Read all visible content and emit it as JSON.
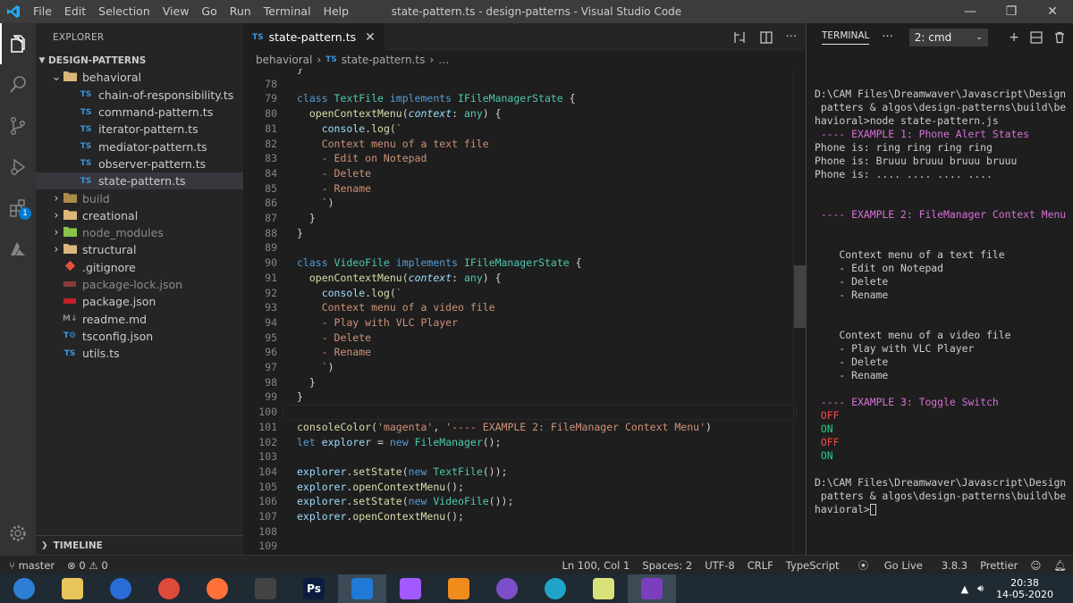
{
  "titlebar": {
    "menu": [
      "File",
      "Edit",
      "Selection",
      "View",
      "Go",
      "Run",
      "Terminal",
      "Help"
    ],
    "title": "state-pattern.ts - design-patterns - Visual Studio Code"
  },
  "activity": {
    "extensions_badge": "1"
  },
  "explorer": {
    "header": "EXPLORER",
    "root": "DESIGN-PATTERNS",
    "items": [
      {
        "label": "behavioral",
        "kind": "folder-open",
        "depth": 1
      },
      {
        "label": "chain-of-responsibility.ts",
        "kind": "ts",
        "depth": 2
      },
      {
        "label": "command-pattern.ts",
        "kind": "ts",
        "depth": 2
      },
      {
        "label": "iterator-pattern.ts",
        "kind": "ts",
        "depth": 2
      },
      {
        "label": "mediator-pattern.ts",
        "kind": "ts",
        "depth": 2
      },
      {
        "label": "observer-pattern.ts",
        "kind": "ts",
        "depth": 2
      },
      {
        "label": "state-pattern.ts",
        "kind": "ts",
        "depth": 2,
        "selected": true
      },
      {
        "label": "build",
        "kind": "folder-dim",
        "depth": 1
      },
      {
        "label": "creational",
        "kind": "folder",
        "depth": 1
      },
      {
        "label": "node_modules",
        "kind": "folder-node",
        "depth": 1
      },
      {
        "label": "structural",
        "kind": "folder",
        "depth": 1
      },
      {
        "label": ".gitignore",
        "kind": "git",
        "depth": 1
      },
      {
        "label": "package-lock.json",
        "kind": "npm-dim",
        "depth": 1
      },
      {
        "label": "package.json",
        "kind": "npm",
        "depth": 1
      },
      {
        "label": "readme.md",
        "kind": "md",
        "depth": 1
      },
      {
        "label": "tsconfig.json",
        "kind": "tsconfig",
        "depth": 1
      },
      {
        "label": "utils.ts",
        "kind": "ts",
        "depth": 1
      }
    ],
    "timeline": "TIMELINE",
    "icons": {
      "ts": "TS",
      "md": "M↓",
      "tsconfig": "T⚙"
    }
  },
  "editor": {
    "tab_label": "state-pattern.ts",
    "tab_icon": "TS",
    "breadcrumb": [
      "behavioral",
      "state-pattern.ts",
      "…"
    ],
    "breadcrumb_icon": "TS",
    "code": [
      {
        "n": "",
        "parts": [
          [
            "pl",
            "}"
          ]
        ]
      },
      {
        "n": "78",
        "parts": []
      },
      {
        "n": "79",
        "parts": [
          [
            "kb",
            "class "
          ],
          [
            "cls",
            "TextFile "
          ],
          [
            "kb",
            "implements "
          ],
          [
            "cls",
            "IFileManagerState "
          ],
          [
            "pl",
            "{"
          ]
        ]
      },
      {
        "n": "80",
        "parts": [
          [
            "pl",
            "  "
          ],
          [
            "fn",
            "openContextMenu"
          ],
          [
            "pl",
            "("
          ],
          [
            "prm",
            "context"
          ],
          [
            "pl",
            ": "
          ],
          [
            "ty",
            "any"
          ],
          [
            "pl",
            ") {"
          ]
        ]
      },
      {
        "n": "81",
        "parts": [
          [
            "pl",
            "    "
          ],
          [
            "vr",
            "console"
          ],
          [
            "pl",
            "."
          ],
          [
            "fn",
            "log"
          ],
          [
            "pl",
            "("
          ],
          [
            "str",
            "`"
          ]
        ]
      },
      {
        "n": "82",
        "parts": [
          [
            "str",
            "    Context menu of a text file"
          ]
        ]
      },
      {
        "n": "83",
        "parts": [
          [
            "str",
            "    - Edit on Notepad"
          ]
        ]
      },
      {
        "n": "84",
        "parts": [
          [
            "str",
            "    - Delete"
          ]
        ]
      },
      {
        "n": "85",
        "parts": [
          [
            "str",
            "    - Rename"
          ]
        ]
      },
      {
        "n": "86",
        "parts": [
          [
            "str",
            "    `"
          ],
          [
            "pl",
            ")"
          ]
        ]
      },
      {
        "n": "87",
        "parts": [
          [
            "pl",
            "  }"
          ]
        ]
      },
      {
        "n": "88",
        "parts": [
          [
            "pl",
            "}"
          ]
        ]
      },
      {
        "n": "89",
        "parts": []
      },
      {
        "n": "90",
        "parts": [
          [
            "kb",
            "class "
          ],
          [
            "cls",
            "VideoFile "
          ],
          [
            "kb",
            "implements "
          ],
          [
            "cls",
            "IFileManagerState "
          ],
          [
            "pl",
            "{"
          ]
        ]
      },
      {
        "n": "91",
        "parts": [
          [
            "pl",
            "  "
          ],
          [
            "fn",
            "openContextMenu"
          ],
          [
            "pl",
            "("
          ],
          [
            "prm",
            "context"
          ],
          [
            "pl",
            ": "
          ],
          [
            "ty",
            "any"
          ],
          [
            "pl",
            ") {"
          ]
        ]
      },
      {
        "n": "92",
        "parts": [
          [
            "pl",
            "    "
          ],
          [
            "vr",
            "console"
          ],
          [
            "pl",
            "."
          ],
          [
            "fn",
            "log"
          ],
          [
            "pl",
            "("
          ],
          [
            "str",
            "`"
          ]
        ]
      },
      {
        "n": "93",
        "parts": [
          [
            "str",
            "    Context menu of a video file"
          ]
        ]
      },
      {
        "n": "94",
        "parts": [
          [
            "str",
            "    - Play with VLC Player"
          ]
        ]
      },
      {
        "n": "95",
        "parts": [
          [
            "str",
            "    - Delete"
          ]
        ]
      },
      {
        "n": "96",
        "parts": [
          [
            "str",
            "    - Rename"
          ]
        ]
      },
      {
        "n": "97",
        "parts": [
          [
            "str",
            "    `"
          ],
          [
            "pl",
            ")"
          ]
        ]
      },
      {
        "n": "98",
        "parts": [
          [
            "pl",
            "  }"
          ]
        ]
      },
      {
        "n": "99",
        "parts": [
          [
            "pl",
            "}"
          ]
        ]
      },
      {
        "n": "100",
        "parts": [],
        "current": true
      },
      {
        "n": "101",
        "parts": [
          [
            "fn",
            "consoleColor"
          ],
          [
            "pl",
            "("
          ],
          [
            "str",
            "'magenta'"
          ],
          [
            "pl",
            ", "
          ],
          [
            "str",
            "'---- EXAMPLE 2: FileManager Context Menu'"
          ],
          [
            "pl",
            ")"
          ]
        ]
      },
      {
        "n": "102",
        "parts": [
          [
            "kb",
            "let "
          ],
          [
            "vr",
            "explorer "
          ],
          [
            "pl",
            "= "
          ],
          [
            "kb",
            "new "
          ],
          [
            "cls",
            "FileManager"
          ],
          [
            "pl",
            "();"
          ]
        ]
      },
      {
        "n": "103",
        "parts": []
      },
      {
        "n": "104",
        "parts": [
          [
            "vr",
            "explorer"
          ],
          [
            "pl",
            "."
          ],
          [
            "fn",
            "setState"
          ],
          [
            "pl",
            "("
          ],
          [
            "kb",
            "new "
          ],
          [
            "cls",
            "TextFile"
          ],
          [
            "pl",
            "());"
          ]
        ]
      },
      {
        "n": "105",
        "parts": [
          [
            "vr",
            "explorer"
          ],
          [
            "pl",
            "."
          ],
          [
            "fn",
            "openContextMenu"
          ],
          [
            "pl",
            "();"
          ]
        ]
      },
      {
        "n": "106",
        "parts": [
          [
            "vr",
            "explorer"
          ],
          [
            "pl",
            "."
          ],
          [
            "fn",
            "setState"
          ],
          [
            "pl",
            "("
          ],
          [
            "kb",
            "new "
          ],
          [
            "cls",
            "VideoFile"
          ],
          [
            "pl",
            "());"
          ]
        ]
      },
      {
        "n": "107",
        "parts": [
          [
            "vr",
            "explorer"
          ],
          [
            "pl",
            "."
          ],
          [
            "fn",
            "openContextMenu"
          ],
          [
            "pl",
            "();"
          ]
        ]
      },
      {
        "n": "108",
        "parts": []
      },
      {
        "n": "109",
        "parts": []
      }
    ]
  },
  "terminal": {
    "tab": "TERMINAL",
    "more": "···",
    "selector": "2: cmd",
    "lines": [
      {
        "c": "",
        "t": ""
      },
      {
        "c": "",
        "t": "D:\\CAM Files\\Dreamwaver\\Javascript\\Design"
      },
      {
        "c": "",
        "t": " patters & algos\\design-patterns\\build\\be"
      },
      {
        "c": "",
        "t": "havioral>node state-pattern.js"
      },
      {
        "c": "mag",
        "t": " ---- EXAMPLE 1: Phone Alert States"
      },
      {
        "c": "",
        "t": "Phone is: ring ring ring ring"
      },
      {
        "c": "",
        "t": "Phone is: Bruuu bruuu bruuu bruuu"
      },
      {
        "c": "",
        "t": "Phone is: .... .... .... ...."
      },
      {
        "c": "",
        "t": ""
      },
      {
        "c": "",
        "t": ""
      },
      {
        "c": "mag",
        "t": " ---- EXAMPLE 2: FileManager Context Menu"
      },
      {
        "c": "",
        "t": ""
      },
      {
        "c": "",
        "t": ""
      },
      {
        "c": "",
        "t": "    Context menu of a text file"
      },
      {
        "c": "",
        "t": "    - Edit on Notepad"
      },
      {
        "c": "",
        "t": "    - Delete"
      },
      {
        "c": "",
        "t": "    - Rename"
      },
      {
        "c": "",
        "t": ""
      },
      {
        "c": "",
        "t": ""
      },
      {
        "c": "",
        "t": "    Context menu of a video file"
      },
      {
        "c": "",
        "t": "    - Play with VLC Player"
      },
      {
        "c": "",
        "t": "    - Delete"
      },
      {
        "c": "",
        "t": "    - Rename"
      },
      {
        "c": "",
        "t": ""
      },
      {
        "c": "mag",
        "t": " ---- EXAMPLE 3: Toggle Switch"
      },
      {
        "c": "red",
        "t": " OFF"
      },
      {
        "c": "grn",
        "t": " ON"
      },
      {
        "c": "red",
        "t": " OFF"
      },
      {
        "c": "grn",
        "t": " ON"
      },
      {
        "c": "",
        "t": ""
      },
      {
        "c": "",
        "t": "D:\\CAM Files\\Dreamwaver\\Javascript\\Design"
      },
      {
        "c": "",
        "t": " patters & algos\\design-patterns\\build\\be"
      },
      {
        "c": "",
        "t": "havioral>",
        "cursor": true
      }
    ]
  },
  "status": {
    "branch": "master",
    "errors": "0",
    "warnings": "0",
    "position": "Ln 100, Col 1",
    "spaces": "Spaces: 2",
    "encoding": "UTF-8",
    "eol": "CRLF",
    "language": "TypeScript",
    "golive": "Go Live",
    "version": "3.8.3",
    "prettier": "Prettier"
  },
  "taskbar": {
    "apps": [
      {
        "name": "start",
        "label": "",
        "color": "#2c7fd4"
      },
      {
        "name": "file-explorer",
        "label": "",
        "color": "#e8c45a"
      },
      {
        "name": "firefox-developer",
        "label": "",
        "color": "#2a6cd6"
      },
      {
        "name": "chrome",
        "label": "",
        "color": "#dd4b39"
      },
      {
        "name": "firefox",
        "label": "",
        "color": "#ff7139"
      },
      {
        "name": "inkscape",
        "label": "",
        "color": "#444"
      },
      {
        "name": "photoshop",
        "label": "Ps",
        "color": "#0b1c3f"
      },
      {
        "name": "vscode",
        "label": "",
        "color": "#1e7ad6",
        "active": true
      },
      {
        "name": "figma",
        "label": "",
        "color": "#a259ff"
      },
      {
        "name": "sublime",
        "label": "",
        "color": "#f08c1c"
      },
      {
        "name": "tor-browser",
        "label": "",
        "color": "#7b4fc9"
      },
      {
        "name": "edge",
        "label": "",
        "color": "#1fa3c9"
      },
      {
        "name": "sticky-notes",
        "label": "",
        "color": "#d9e27a"
      },
      {
        "name": "visual-studio",
        "label": "",
        "color": "#7b3fbd",
        "active": true
      }
    ],
    "time": "20:38",
    "date": "14-05-2020"
  }
}
